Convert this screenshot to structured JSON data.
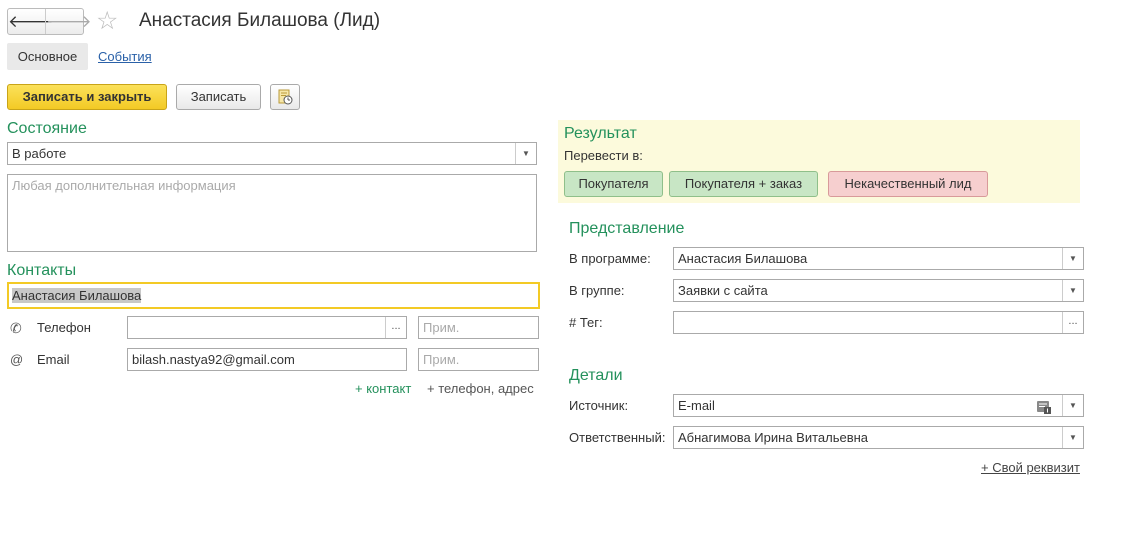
{
  "window": {
    "title": "Анастасия Билашова (Лид)"
  },
  "nav": {
    "back": "🡐",
    "forward": "🡒",
    "favorite": "☆"
  },
  "tabs": [
    {
      "label": "Основное",
      "active": true
    },
    {
      "label": "События",
      "active": false
    }
  ],
  "toolbar": {
    "save_close": "Записать и закрыть",
    "save": "Записать"
  },
  "state": {
    "title": "Состояние",
    "status_value": "В работе",
    "comment_placeholder": "Любая дополнительная информация"
  },
  "contacts": {
    "title": "Контакты",
    "name": "Анастасия Билашова",
    "phone_label": "Телефон",
    "phone_value": "",
    "phone_note_placeholder": "Прим.",
    "email_label": "Email",
    "email_value": "bilash.nastya92@gmail.com",
    "email_note_placeholder": "Прим.",
    "add_contact": "+ контакт",
    "add_phone_address": "+ телефон, адрес"
  },
  "result": {
    "title": "Результат",
    "convert_label": "Перевести в:",
    "buttons": [
      "Покупателя",
      "Покупателя + заказ",
      "Некачественный лид"
    ]
  },
  "representation": {
    "title": "Представление",
    "in_program_label": "В программе:",
    "in_program_value": "Анастасия Билашова",
    "in_group_label": "В группе:",
    "in_group_value": "Заявки с сайта",
    "tag_label": "# Тег:",
    "tag_value": ""
  },
  "details": {
    "title": "Детали",
    "source_label": "Источник:",
    "source_value": "E-mail",
    "responsible_label": "Ответственный:",
    "responsible_value": "Абнагимова Ирина Витальевна",
    "custom_attr_link": "+ Свой реквизит"
  },
  "colors": {
    "accent_green": "#24915c",
    "primary_button": "#f3ca25",
    "link_blue": "#2a61a8"
  }
}
